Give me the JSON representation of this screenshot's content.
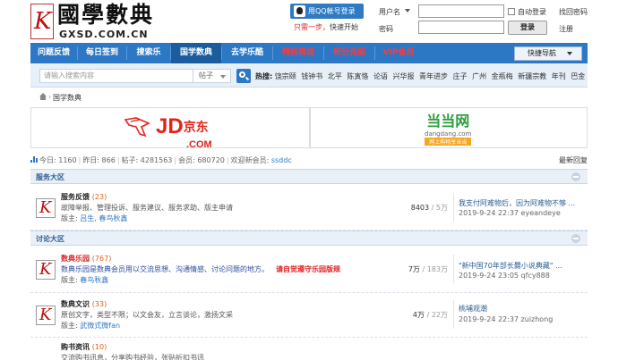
{
  "header": {
    "logo_glyph": "K",
    "logo_title": "國學數典",
    "logo_domain": "GXSD.COM.CN",
    "qq_button": "用QQ帐号登录",
    "qq_sub_1": "只需一步，",
    "qq_sub_2": "快速开始",
    "login": {
      "username_label": "用户名",
      "password_label": "密码",
      "auto_login": "自动登录",
      "forgot_password": "找回密码",
      "login_button": "登录",
      "register": "注册"
    }
  },
  "nav": {
    "items": [
      {
        "label": "问题反馈"
      },
      {
        "label": "每日签到"
      },
      {
        "label": "搜索乐"
      },
      {
        "label": "国学数典"
      },
      {
        "label": "去学乐酷"
      },
      {
        "label": "特别商城"
      },
      {
        "label": "积分充值"
      },
      {
        "label": "VIP会员"
      }
    ],
    "quick_nav": "快捷导航"
  },
  "search": {
    "placeholder": "请输入搜索内容",
    "type": "帖子",
    "hot_label": "热搜:",
    "hot_terms": [
      "饶宗颐",
      "钱钟书",
      "北平",
      "陈寅恪",
      "论语",
      "兴华报",
      "青年进步",
      "庄子",
      "广州",
      "金瓶梅",
      "新疆宗教",
      "年刊",
      "巴金"
    ]
  },
  "breadcrumb": "国学数典",
  "ads": {
    "jd_main": "JD",
    "jd_cn": "京东",
    "jd_com": ".COM",
    "dd_main": "当当网",
    "dd_url": "dangdang.com",
    "dd_slogan": "网上购物享当当"
  },
  "stats": {
    "today": "今日: 1160",
    "yesterday": "昨日: 866",
    "posts": "帖子: 4281563",
    "members": "会员: 680720",
    "welcome": "欢迎新会员:",
    "new_member": "ssddc",
    "latest_reply": "最新回复"
  },
  "sections": [
    {
      "title": "服务大区",
      "forums": [
        {
          "name": "服务反馈",
          "count": "(23)",
          "desc": "故障举报、管理投诉、服务建议、服务求助、版主申请",
          "mod_label": "版主:",
          "mods": "吕生, 春鸟秋鑫",
          "nums": "8403",
          "nums_sub": "5万",
          "last_title": "我支付阿难物后，因为阿难物不够 ...",
          "last_meta": "2019-9-24 22:37 eyeandeye"
        }
      ]
    },
    {
      "title": "讨论大区",
      "forums": [
        {
          "name": "数典乐园",
          "count": "(767)",
          "desc": "数典乐园是数典会员用以交流思想、沟通情感、讨论问题的地方。",
          "notice": "请自觉遵守乐园版规",
          "mod_label": "版主:",
          "mods": "春鸟秋鑫",
          "nums": "7万",
          "nums_sub": "183万",
          "last_title": "\"新中国70年部长爨小说典藏\" ...",
          "last_meta": "2019-9-24 23:05 qfcy888"
        },
        {
          "name": "数典文识",
          "count": "(33)",
          "desc": "原创文字，类型不限；以文会友，立言谈论，激扬文采",
          "mod_label": "版主:",
          "mods": "武微式微fan",
          "nums": "4万",
          "nums_sub": "22万",
          "last_title": "桃埔观潮",
          "last_meta": "2019-9-24 22:37 zuizhong"
        },
        {
          "name": "购书资讯",
          "count": "(10)",
          "desc": "交流购书讯息，分享购书经验，张贴折扣书讯",
          "mod_label": "",
          "mods": "",
          "nums": "",
          "nums_sub": "",
          "last_title": "",
          "last_meta": ""
        }
      ]
    }
  ]
}
